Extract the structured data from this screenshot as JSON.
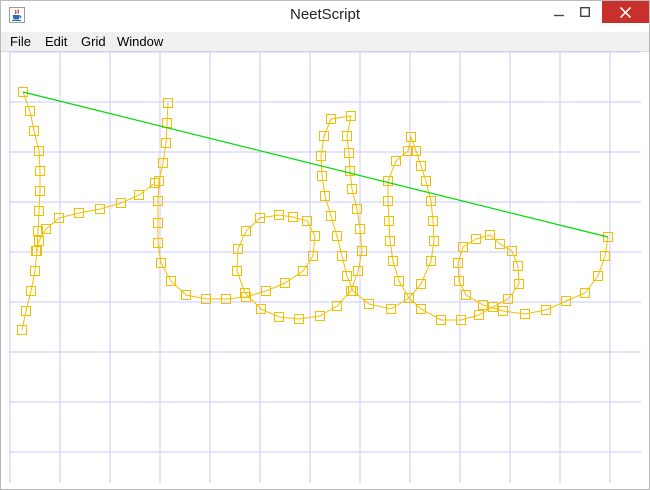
{
  "window": {
    "title": "NeetScript",
    "icon": "java-coffee-cup-icon",
    "controls": [
      "minimize-icon",
      "maximize-icon",
      "close-icon"
    ]
  },
  "menu": {
    "items": [
      {
        "label": "File"
      },
      {
        "label": "Edit"
      },
      {
        "label": "Grid"
      },
      {
        "label": "Window"
      }
    ]
  },
  "colors": {
    "grid": "#c8c8ff",
    "stroke": "#f0c000",
    "guide_line": "#00dd00",
    "close_button": "#c7302b"
  }
}
